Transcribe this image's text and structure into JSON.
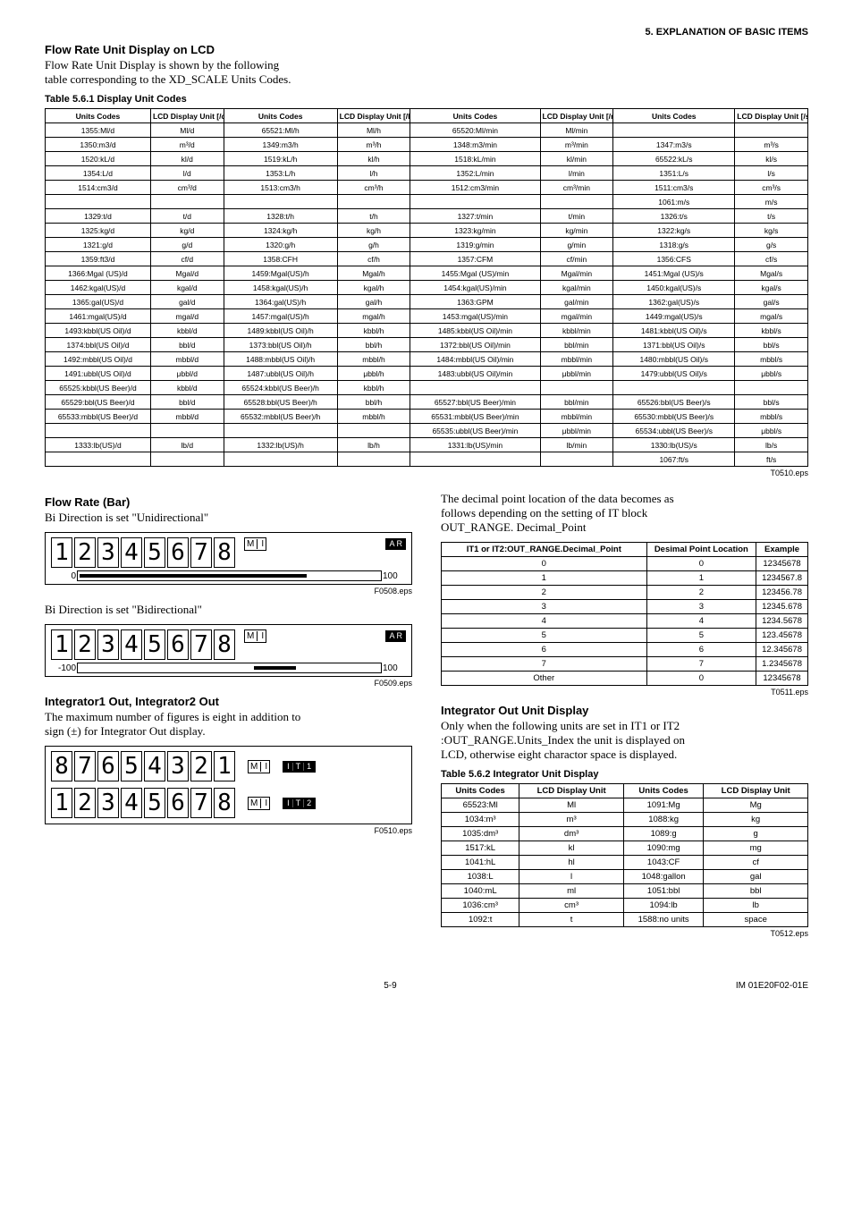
{
  "header": "5.  EXPLANATION OF BASIC ITEMS",
  "flow_lcd": {
    "title": "Flow Rate Unit Display on LCD",
    "body1": "Flow Rate Unit Display is shown by the following",
    "body2": "table corresponding to the XD_SCALE Units Codes.",
    "table_caption": "Table 5.6.1 Display Unit Codes",
    "eps": "T0510.eps",
    "headers": [
      "Units Codes",
      "LCD Display Unit [/d]",
      "Units Codes",
      "LCD Display Unit [/h]",
      "Units Codes",
      "LCD Display Unit [/min]",
      "Units Codes",
      "LCD Display Unit [/s]"
    ],
    "rows": [
      [
        "1355:Ml/d",
        "Ml/d",
        "65521:Ml/h",
        "Ml/h",
        "65520:Ml/min",
        "Ml/min",
        "",
        ""
      ],
      [
        "1350:m3/d",
        "m³/d",
        "1349:m3/h",
        "m³/h",
        "1348:m3/min",
        "m³/min",
        "1347:m3/s",
        "m³/s"
      ],
      [
        "1520:kL/d",
        "kl/d",
        "1519:kL/h",
        "kl/h",
        "1518:kL/min",
        "kl/min",
        "65522:kL/s",
        "kl/s"
      ],
      [
        "1354:L/d",
        "l/d",
        "1353:L/h",
        "l/h",
        "1352:L/min",
        "l/min",
        "1351:L/s",
        "l/s"
      ],
      [
        "1514:cm3/d",
        "cm³/d",
        "1513:cm3/h",
        "cm³/h",
        "1512:cm3/min",
        "cm³/min",
        "1511:cm3/s",
        "cm³/s"
      ],
      [
        "",
        "",
        "",
        "",
        "",
        "",
        "1061:m/s",
        "m/s"
      ],
      [
        "1329:t/d",
        "t/d",
        "1328:t/h",
        "t/h",
        "1327:t/min",
        "t/min",
        "1326:t/s",
        "t/s"
      ],
      [
        "1325:kg/d",
        "kg/d",
        "1324:kg/h",
        "kg/h",
        "1323:kg/min",
        "kg/min",
        "1322:kg/s",
        "kg/s"
      ],
      [
        "1321:g/d",
        "g/d",
        "1320:g/h",
        "g/h",
        "1319:g/min",
        "g/min",
        "1318:g/s",
        "g/s"
      ],
      [
        "1359:ft3/d",
        "cf/d",
        "1358:CFH",
        "cf/h",
        "1357:CFM",
        "cf/min",
        "1356:CFS",
        "cf/s"
      ],
      [
        "1366:Mgal (US)/d",
        "Mgal/d",
        "1459:Mgal(US)/h",
        "Mgal/h",
        "1455:Mgal (US)/min",
        "Mgal/min",
        "1451:Mgal (US)/s",
        "Mgal/s"
      ],
      [
        "1462:kgal(US)/d",
        "kgal/d",
        "1458:kgal(US)/h",
        "kgal/h",
        "1454:kgal(US)/min",
        "kgal/min",
        "1450:kgal(US)/s",
        "kgal/s"
      ],
      [
        "1365:gal(US)/d",
        "gal/d",
        "1364:gal(US)/h",
        "gal/h",
        "1363:GPM",
        "gal/min",
        "1362:gal(US)/s",
        "gal/s"
      ],
      [
        "1461:mgal(US)/d",
        "mgal/d",
        "1457:mgal(US)/h",
        "mgal/h",
        "1453:mgal(US)/min",
        "mgal/min",
        "1449:mgal(US)/s",
        "mgal/s"
      ],
      [
        "1493:kbbl(US Oil)/d",
        "kbbl/d",
        "1489:kbbl(US Oil)/h",
        "kbbl/h",
        "1485:kbbl(US Oil)/min",
        "kbbl/min",
        "1481:kbbl(US Oil)/s",
        "kbbl/s"
      ],
      [
        "1374:bbl(US Oil)/d",
        "bbl/d",
        "1373:bbl(US Oil)/h",
        "bbl/h",
        "1372:bbl(US Oil)/min",
        "bbl/min",
        "1371:bbl(US Oil)/s",
        "bbl/s"
      ],
      [
        "1492:mbbl(US Oil)/d",
        "mbbl/d",
        "1488:mbbl(US Oil)/h",
        "mbbl/h",
        "1484:mbbl(US Oil)/min",
        "mbbl/min",
        "1480:mbbl(US Oil)/s",
        "mbbl/s"
      ],
      [
        "1491:ubbl(US Oil)/d",
        "μbbl/d",
        "1487:ubbl(US Oil)/h",
        "μbbl/h",
        "1483:ubbl(US Oil)/min",
        "μbbl/min",
        "1479:ubbl(US Oil)/s",
        "μbbl/s"
      ],
      [
        "65525:kbbl(US Beer)/d",
        "kbbl/d",
        "65524:kbbl(US Beer)/h",
        "kbbl/h",
        "",
        "",
        "",
        ""
      ],
      [
        "65529:bbl(US Beer)/d",
        "bbl/d",
        "65528:bbl(US Beer)/h",
        "bbl/h",
        "65527:bbl(US Beer)/min",
        "bbl/min",
        "65526:bbl(US Beer)/s",
        "bbl/s"
      ],
      [
        "65533:mbbl(US Beer)/d",
        "mbbl/d",
        "65532:mbbl(US Beer)/h",
        "mbbl/h",
        "65531:mbbl(US Beer)/min",
        "mbbl/min",
        "65530:mbbl(US Beer)/s",
        "mbbl/s"
      ],
      [
        "",
        "",
        "",
        "",
        "65535:ubbl(US Beer)/min",
        "μbbl/min",
        "65534:ubbl(US Beer)/s",
        "μbbl/s"
      ],
      [
        "1333:lb(US)/d",
        "lb/d",
        "1332:lb(US)/h",
        "lb/h",
        "1331:lb(US)/min",
        "lb/min",
        "1330:lb(US)/s",
        "lb/s"
      ],
      [
        "",
        "",
        "",
        "",
        "",
        "",
        "1067:ft/s",
        "ft/s"
      ]
    ]
  },
  "flow_bar": {
    "title": "Flow Rate (Bar)",
    "uni_text": "Bi Direction is set \"Unidirectional\"",
    "bi_text": "Bi Direction is set \"Bidirectional\"",
    "digits": [
      "1",
      "2",
      "3",
      "4",
      "5",
      "6",
      "7",
      "8"
    ],
    "digits_bi": [
      "1",
      "2",
      "3",
      "4",
      "5",
      "6",
      "7",
      "8"
    ],
    "mi": [
      "M",
      "I"
    ],
    "ar": "A R",
    "eps1": "F0508.eps",
    "eps2": "F0509.eps",
    "left0": "0",
    "leftNeg": "-100",
    "right100": "100"
  },
  "int_out": {
    "title": "Integrator1 Out, Integrator2 Out",
    "body1": "The maximum number of figures is eight in addition to",
    "body2": "sign (±) for Integrator Out display.",
    "row1": [
      "8",
      "7",
      "6",
      "5",
      "4",
      "3",
      "2",
      "1"
    ],
    "row2": [
      "1",
      "2",
      "3",
      "4",
      "5",
      "6",
      "7",
      "8"
    ],
    "it1": [
      "I",
      "T",
      "1"
    ],
    "it2": [
      "I",
      "T",
      "2"
    ],
    "eps": "F0510.eps"
  },
  "decimal": {
    "body1": "The decimal point location of the data becomes as",
    "body2": "follows depending on the setting of IT block",
    "body3": "OUT_RANGE. Decimal_Point",
    "headers": [
      "IT1 or IT2:OUT_RANGE.Decimal_Point",
      "Desimal Point Location",
      "Example"
    ],
    "rows": [
      [
        "0",
        "0",
        "12345678"
      ],
      [
        "1",
        "1",
        "1234567.8"
      ],
      [
        "2",
        "2",
        "123456.78"
      ],
      [
        "3",
        "3",
        "12345.678"
      ],
      [
        "4",
        "4",
        "1234.5678"
      ],
      [
        "5",
        "5",
        "123.45678"
      ],
      [
        "6",
        "6",
        "12.345678"
      ],
      [
        "7",
        "7",
        "1.2345678"
      ],
      [
        "Other",
        "0",
        "12345678"
      ]
    ],
    "eps": "T0511.eps"
  },
  "int_unit": {
    "title": "Integrator Out Unit Display",
    "body1": "Only when the following units are set in IT1 or IT2",
    "body2": ":OUT_RANGE.Units_Index the unit is displayed on",
    "body3": "LCD, otherwise eight charactor space is displayed.",
    "caption": "Table 5.6.2 Integrator Unit Display",
    "headers": [
      "Units Codes",
      "LCD Display Unit",
      "Units Codes",
      "LCD Display Unit"
    ],
    "rows": [
      [
        "65523:Ml",
        "Ml",
        "1091:Mg",
        "Mg"
      ],
      [
        "1034:m³",
        "m³",
        "1088:kg",
        "kg"
      ],
      [
        "1035:dm³",
        "dm³",
        "1089:g",
        "g"
      ],
      [
        "1517:kL",
        "kl",
        "1090:mg",
        "mg"
      ],
      [
        "1041:hL",
        "hl",
        "1043:CF",
        "cf"
      ],
      [
        "1038:L",
        "l",
        "1048:gallon",
        "gal"
      ],
      [
        "1040:mL",
        "ml",
        "1051:bbl",
        "bbl"
      ],
      [
        "1036:cm³",
        "cm³",
        "1094:lb",
        "lb"
      ],
      [
        "1092:t",
        "t",
        "1588:no units",
        "space"
      ]
    ],
    "eps": "T0512.eps"
  },
  "footer": {
    "page": "5-9",
    "doc": "IM 01E20F02-01E"
  }
}
